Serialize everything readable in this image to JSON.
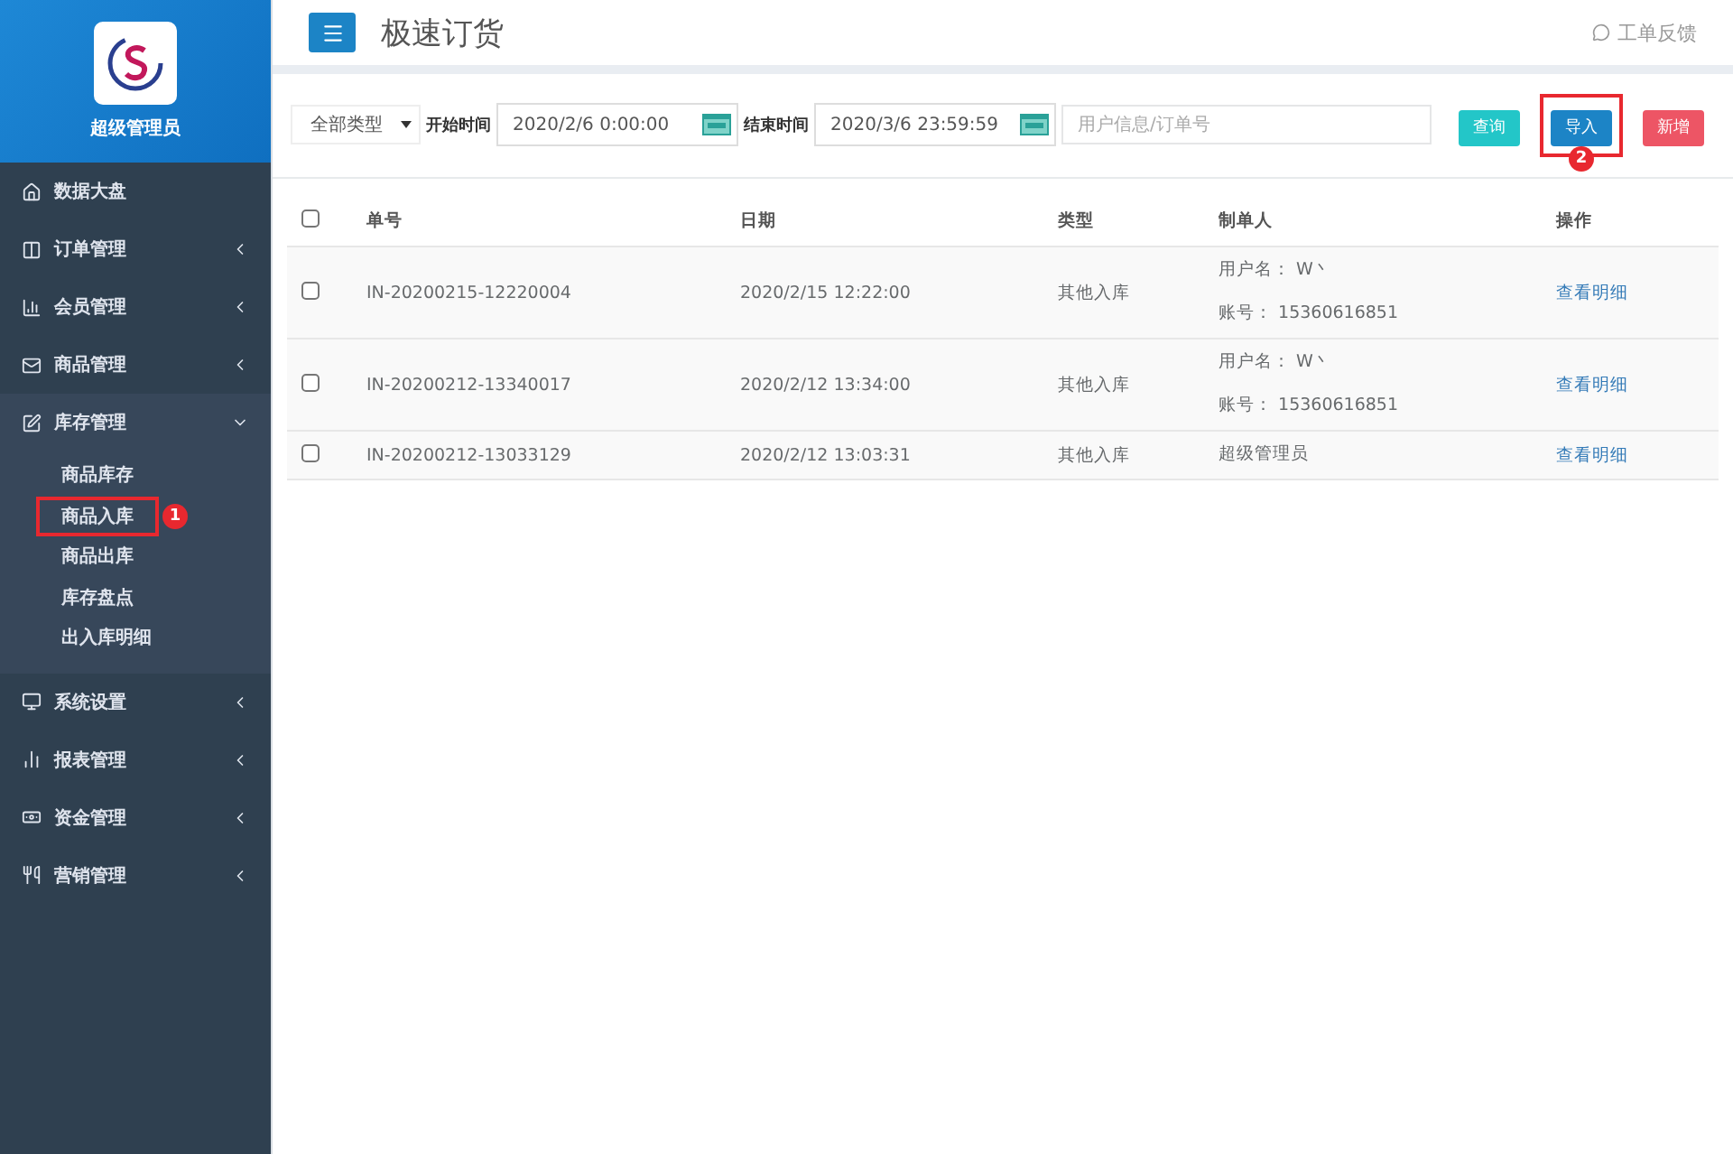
{
  "sidebar": {
    "user": "超级管理员",
    "items": [
      {
        "label": "数据大盘",
        "expandable": false
      },
      {
        "label": "订单管理",
        "expandable": true,
        "expanded": false
      },
      {
        "label": "会员管理",
        "expandable": true,
        "expanded": false
      },
      {
        "label": "商品管理",
        "expandable": true,
        "expanded": false
      },
      {
        "label": "库存管理",
        "expandable": true,
        "expanded": true,
        "children": [
          {
            "label": "商品库存"
          },
          {
            "label": "商品入库",
            "callout": "1"
          },
          {
            "label": "商品出库"
          },
          {
            "label": "库存盘点"
          },
          {
            "label": "出入库明细"
          }
        ]
      },
      {
        "label": "系统设置",
        "expandable": true,
        "expanded": false
      },
      {
        "label": "报表管理",
        "expandable": true,
        "expanded": false
      },
      {
        "label": "资金管理",
        "expandable": true,
        "expanded": false
      },
      {
        "label": "营销管理",
        "expandable": true,
        "expanded": false
      }
    ]
  },
  "header": {
    "title": "极速订货",
    "feedback": "工单反馈"
  },
  "filters": {
    "type": "全部类型",
    "start_label": "开始时间",
    "start": "2020/2/6 0:00:00",
    "end_label": "结束时间",
    "end": "2020/3/6 23:59:59",
    "search_placeholder": "用户信息/订单号",
    "buttons": [
      {
        "label": "查询",
        "kind": "query"
      },
      {
        "label": "导入",
        "kind": "import",
        "callout": "2"
      },
      {
        "label": "新增",
        "kind": "add"
      }
    ]
  },
  "table": {
    "select_all_checked": false,
    "columns": [
      "单号",
      "日期",
      "类型",
      "制单人",
      "操作"
    ],
    "rows": [
      {
        "checked": false,
        "number": "IN-20200215-12220004",
        "date": "2020/2/15 12:22:00",
        "type": "其他入库",
        "creator": [
          "用户名： W丶",
          "账号： 15360616851"
        ],
        "action": "查看明细"
      },
      {
        "checked": false,
        "number": "IN-20200212-13340017",
        "date": "2020/2/12 13:34:00",
        "type": "其他入库",
        "creator": [
          "用户名： W丶",
          "账号： 15360616851"
        ],
        "action": "查看明细"
      },
      {
        "checked": false,
        "number": "IN-20200212-13033129",
        "date": "2020/2/12 13:03:31",
        "type": "其他入库",
        "creator": [
          "超级管理员"
        ],
        "action": "查看明细"
      }
    ]
  }
}
